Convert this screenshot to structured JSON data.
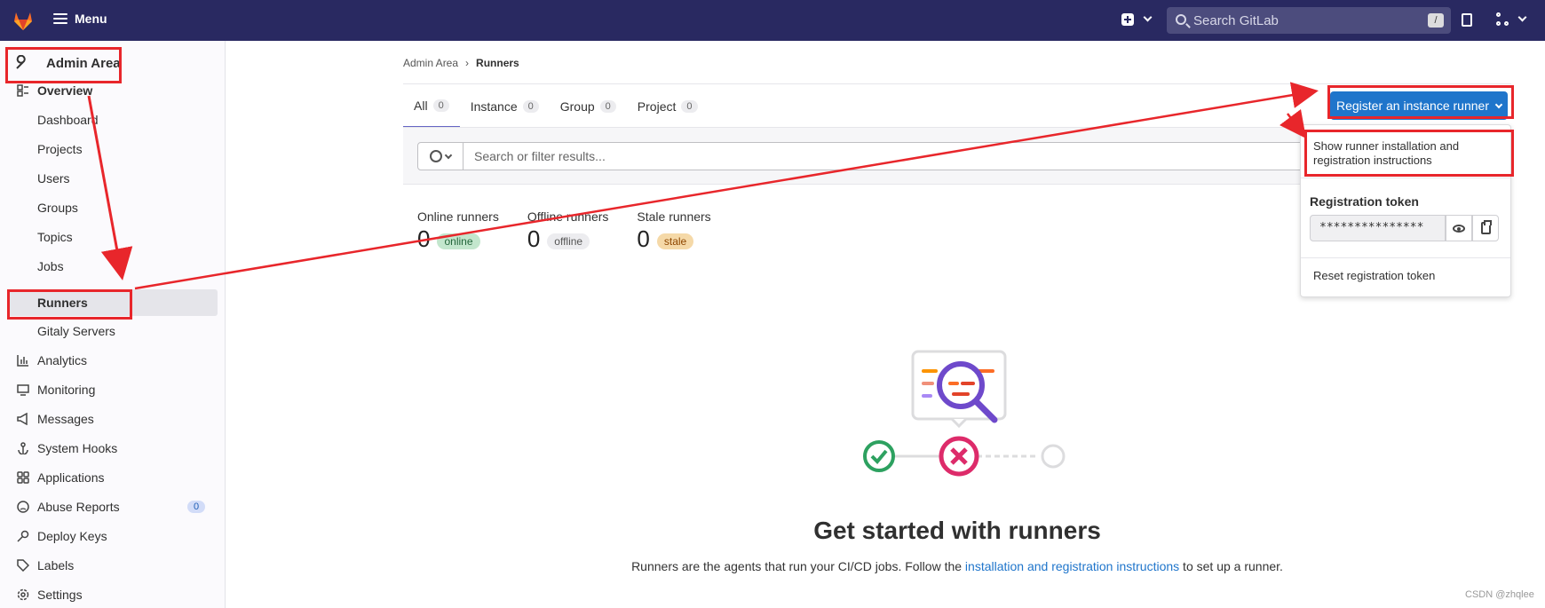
{
  "topbar": {
    "menu_label": "Menu",
    "search_placeholder": "Search GitLab",
    "search_shortcut": "/"
  },
  "sidebar": {
    "title": "Admin Area",
    "items": [
      {
        "label": "Overview",
        "icon": "overview-icon"
      },
      {
        "label": "Dashboard"
      },
      {
        "label": "Projects"
      },
      {
        "label": "Users"
      },
      {
        "label": "Groups"
      },
      {
        "label": "Topics"
      },
      {
        "label": "Jobs"
      },
      {
        "label": "Runners"
      },
      {
        "label": "Gitaly Servers"
      },
      {
        "label": "Analytics",
        "icon": "chart-icon"
      },
      {
        "label": "Monitoring",
        "icon": "monitor-icon"
      },
      {
        "label": "Messages",
        "icon": "megaphone-icon"
      },
      {
        "label": "System Hooks",
        "icon": "anchor-icon"
      },
      {
        "label": "Applications",
        "icon": "grid-icon"
      },
      {
        "label": "Abuse Reports",
        "icon": "sad-face-icon",
        "count": "0"
      },
      {
        "label": "Deploy Keys",
        "icon": "key-icon"
      },
      {
        "label": "Labels",
        "icon": "label-icon"
      },
      {
        "label": "Settings",
        "icon": "gear-icon"
      }
    ]
  },
  "breadcrumb": {
    "parent": "Admin Area",
    "separator": "›",
    "current": "Runners"
  },
  "tabs": [
    {
      "label": "All",
      "count": "0"
    },
    {
      "label": "Instance",
      "count": "0"
    },
    {
      "label": "Group",
      "count": "0"
    },
    {
      "label": "Project",
      "count": "0"
    }
  ],
  "filter": {
    "placeholder": "Search or filter results..."
  },
  "stats": [
    {
      "title": "Online runners",
      "value": "0",
      "status": "online"
    },
    {
      "title": "Offline runners",
      "value": "0",
      "status": "offline"
    },
    {
      "title": "Stale runners",
      "value": "0",
      "status": "stale"
    }
  ],
  "register": {
    "button_label": "Register an instance runner",
    "instructions_label": "Show runner installation and registration instructions",
    "token_label": "Registration token",
    "token_value": "***************",
    "reset_label": "Reset registration token"
  },
  "empty_state": {
    "title": "Get started with runners",
    "desc_before": "Runners are the agents that run your CI/CD jobs. Follow the ",
    "desc_link": "installation and registration instructions",
    "desc_after": " to set up a runner."
  },
  "watermark": "CSDN @zhqlee",
  "colors": {
    "navbar": "#292961",
    "primary": "#1f75cb",
    "annotation": "#e8262b"
  }
}
